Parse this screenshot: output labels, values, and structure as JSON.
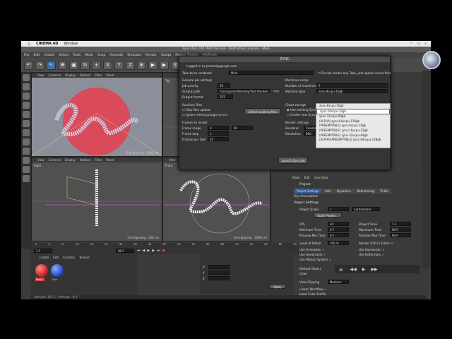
{
  "mac_menubar": {
    "app_name": "CINEMA 4D",
    "window_menu": "Window"
  },
  "app": {
    "title": "Zync-disc.c4d (NFR Version - Restricted License) - Main",
    "menus": [
      "File",
      "Edit",
      "Create",
      "Select",
      "Tools",
      "Mesh",
      "Snap",
      "Animate",
      "Simulate",
      "Render",
      "Sculpt",
      "Motion Tracker",
      "MoGraph"
    ],
    "toolbar_axes": [
      "X",
      "Y",
      "Z"
    ]
  },
  "viewports": {
    "top_left": {
      "menus": [
        "View",
        "Cameras",
        "Display",
        "Options",
        "Filter",
        "Panel"
      ],
      "label": "Perspective",
      "grid": "Grid Spacing : 1000 cm"
    },
    "top_right": {
      "menus": [],
      "label": "Top"
    },
    "bottom_left": {
      "menus": [
        "View",
        "Cameras",
        "Display",
        "Options",
        "Filter",
        "Panel"
      ],
      "label": "Right",
      "grid": "Grid Spacing : 100 cm"
    },
    "bottom_right": {
      "menus": [
        "View",
        "Cameras",
        "Display",
        "Options",
        "Filter",
        "Panel"
      ],
      "label": "Front",
      "grid": "Grid Spacing : 1000 cm"
    }
  },
  "zync_dialog": {
    "title": "ZYNC",
    "logged_in": "Logged in as proeski@google.com",
    "take_label": "Take to be rendered",
    "take_value": "Main",
    "do_not_render_any_take": "Do not render any Take, just upload scene files",
    "general_job_settings": "General job settings",
    "job_priority_label": "Job priority",
    "job_priority_value": "50",
    "output_path_label": "Output path",
    "output_path_value": "/Users/pines/Desktop/Test Renders",
    "output_format_label": "Output format",
    "output_format_value": "TIFF",
    "auxiliary_files": "Auxiliary files",
    "skip_files_upload": "Skip files upload",
    "ignore_missing_plugin": "Ignore missing plugin errors",
    "select_aux_btn": "Select auxiliary files",
    "frames_to_render": "Frames to render",
    "frame_range_label": "Frame range",
    "frame_range_from": "0",
    "frame_range_to": "90",
    "frame_step_label": "Frame step",
    "frame_step_value": "1",
    "frames_per_task_label": "Frames per task",
    "frames_per_task_value": "10",
    "machines_setup": "Machines setup",
    "num_machines_label": "Number of machines",
    "num_machines_value": "5",
    "machine_type_label": "Machine type",
    "machine_type_value": "zync-8vcpu-16gb",
    "cloud_storage": "Cloud storage",
    "use_existing": "Use existing Zync",
    "create_new": "Create new Zync",
    "render_settings": "Render settings",
    "renderer_label": "Renderer",
    "renderer_value": "Cinema",
    "resolution_label": "Resolution",
    "resolution_value": "800",
    "launch_btn": "Launch Zync job",
    "machine_options": [
      "zync-8vcpu-16gb",
      "zync-16vcpu-32gb",
      "zync-32vcpu-64gb",
      "(ALPHA) zync-64vcpu-128gb",
      "(PREEMPTIBLE) zync-8vcpu-16gb",
      "(PREEMPTIBLE) zync-16vcpu-32gb",
      "(PREEMPTIBLE) zync-32vcpu-64gb",
      "(ALPHA)(PREEMPTIBLE) zync-64vcpu-128gb"
    ],
    "highlighted_option_index": 1
  },
  "attributes": {
    "menus": [
      "Mode",
      "Edit",
      "User Data"
    ],
    "header": "Project",
    "tabs": [
      "Project Settings",
      "Info",
      "Dynamics",
      "Referencing",
      "To Do"
    ],
    "sub_tab": "Key Interpolation",
    "section": "Project Settings",
    "project_scale_label": "Project Scale",
    "project_scale_value": "1",
    "project_scale_unit": "Centimeters",
    "scale_project_btn": "Scale Project...",
    "fps_label": "FPS",
    "fps_value": "30",
    "project_time_label": "Project Time",
    "project_time_value": "1 F",
    "min_time_label": "Minimum Time",
    "min_time_value": "0 F",
    "max_time_label": "Maximum Time",
    "max_time_value": "90 F",
    "preview_min_label": "Preview Min Time",
    "preview_min_value": "0 F",
    "preview_max_label": "Preview Max Time",
    "preview_max_value": "90 F",
    "lod_label": "Level of Detail",
    "lod_value": "100 %",
    "render_lod_label": "Render LOD in Editor",
    "use_animation": "Use Animation",
    "use_expression": "Use Expression",
    "use_generators": "Use Generators",
    "use_deformers": "Use Deformers",
    "use_motion_system": "Use Motion System",
    "default_object_label": "Default Object",
    "color_label": "Color",
    "view_clipping_label": "View Clipping",
    "view_clipping_value": "Medium",
    "linear_workflow": "Linear Workflow",
    "input_color_profile": "Input Color Profile"
  },
  "timeline": {
    "ticks": [
      "0",
      "5",
      "10",
      "15",
      "20",
      "25",
      "30",
      "35",
      "40",
      "45",
      "50",
      "55",
      "60",
      "65",
      "70",
      "75",
      "80",
      "85",
      "90"
    ],
    "current_frame": "1 F",
    "end_frame": "90 F",
    "start_field": "0 F"
  },
  "materials": {
    "menus": [
      "Create",
      "Edit",
      "Function",
      "Texture"
    ],
    "items": [
      "Mat.1",
      "Mat"
    ]
  },
  "coordinates": {
    "rows": [
      "X",
      "Y",
      "Z"
    ],
    "apply_btn": "Apply"
  },
  "status": {
    "text": "Azimuth: 192.3°, Altitude: -8.2°"
  },
  "colors": {
    "accent": "#2f5d9a",
    "panel": "#3b3b3b",
    "viewport": "#505050",
    "sphere": "#d94a5a"
  }
}
